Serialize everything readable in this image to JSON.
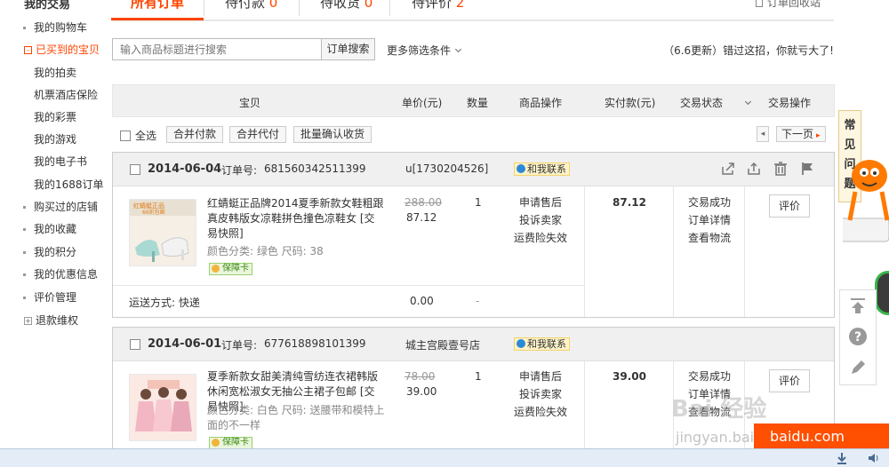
{
  "sidebar": {
    "title": "我的交易",
    "items": [
      {
        "label": "我的购物车",
        "type": "bullet"
      },
      {
        "label": "已买到的宝贝",
        "type": "box",
        "box": "-",
        "active": true
      },
      {
        "label": "我的拍卖",
        "type": "sub"
      },
      {
        "label": "机票酒店保险",
        "type": "sub"
      },
      {
        "label": "我的彩票",
        "type": "sub"
      },
      {
        "label": "我的游戏",
        "type": "sub"
      },
      {
        "label": "我的电子书",
        "type": "sub"
      },
      {
        "label": "我的1688订单",
        "type": "sub"
      },
      {
        "label": "购买过的店铺",
        "type": "bullet"
      },
      {
        "label": "我的收藏",
        "type": "bullet"
      },
      {
        "label": "我的积分",
        "type": "bullet"
      },
      {
        "label": "我的优惠信息",
        "type": "bullet"
      },
      {
        "label": "评价管理",
        "type": "bullet"
      },
      {
        "label": "退款维权",
        "type": "box",
        "box": "+"
      }
    ]
  },
  "tabs": [
    {
      "label": "所有订单",
      "count": ""
    },
    {
      "label": "待付款",
      "count": "0"
    },
    {
      "label": "待收货",
      "count": "0"
    },
    {
      "label": "待评价",
      "count": "2"
    }
  ],
  "recycle_label": "订单回收站",
  "search": {
    "placeholder": "输入商品标题进行搜索",
    "button": "订单搜索",
    "more_filters": "更多筛选条件",
    "notice": "（6.6更新）错过这招，你就亏大了!"
  },
  "table_headers": [
    "宝贝",
    "单价(元)",
    "数量",
    "商品操作",
    "实付款(元)",
    "交易状态",
    "交易操作"
  ],
  "bulk": {
    "select_all": "全选",
    "buttons": [
      "合并付款",
      "合并代付",
      "批量确认收货"
    ],
    "pager_prev": "◂",
    "pager_next": "下一页",
    "pager_next_arrow": "▸"
  },
  "orders": [
    {
      "date": "2014-06-04",
      "order_no_label": "订单号:",
      "order_no": "681560342511399",
      "shop": "u[1730204526]",
      "contact": "和我联系",
      "item": {
        "title": "红蜻蜓正品牌2014夏季新款女鞋粗跟真皮韩版女凉鞋拼色撞色凉鞋女 [交易快照]",
        "spec": "颜色分类: 绿色  尺码: 38",
        "guarantee": "保障卡",
        "price_old": "288.00",
        "price_new": "87.12",
        "qty": "1",
        "ops": [
          "申请售后",
          "投诉卖家",
          "运费险失效"
        ]
      },
      "paid": "87.12",
      "status": [
        "交易成功",
        "订单详情",
        "查看物流"
      ],
      "action": "评价",
      "shipping_label": "运送方式: 快递",
      "shipping_price": "0.00",
      "shipping_dash": "-"
    },
    {
      "date": "2014-06-01",
      "order_no_label": "订单号:",
      "order_no": "677618898101399",
      "shop": "城主宫殿壹号店",
      "contact": "和我联系",
      "item": {
        "title": "夏季新款女甜美清纯雪纺连衣裙韩版休闲宽松淑女无抽公主裙子包邮 [交易快照]",
        "spec": "颜色分类: 白色  尺码: 送腰带和模特上面的不一样",
        "guarantee": "保障卡",
        "price_old": "78.00",
        "price_new": "39.00",
        "qty": "1",
        "ops": [
          "申请售后",
          "投诉卖家",
          "运费险失效"
        ]
      },
      "paid": "39.00",
      "status": [
        "交易成功",
        "订单详情",
        "查看物流"
      ],
      "action": "评价"
    }
  ],
  "faq": [
    "常",
    "见",
    "问",
    "题"
  ],
  "watermark": {
    "brand": "Bai 经验",
    "url": "jingyan.baidu.com",
    "banner": "baidu.com"
  },
  "colors": {
    "accent": "#ff4400",
    "header_bg": "#f0f0f0",
    "baidu_orange": "#ff4f00"
  }
}
